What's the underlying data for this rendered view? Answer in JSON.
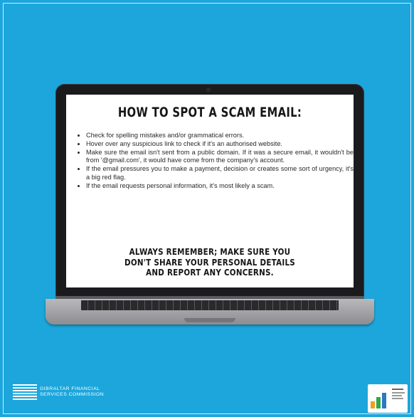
{
  "title": "HOW TO SPOT A SCAM EMAIL:",
  "tips": [
    "Check for spelling mistakes and/or grammatical errors.",
    "Hover over any suspicious link to check if it's an authorised website.",
    "Make sure the email isn't sent from a public domain. If it was a secure email, it wouldn't be from '@gmail.com', it would have come from the company's account.",
    "If the email pressures you to make a payment, decision or creates some sort of urgency, it's a big red flag.",
    "If the email requests personal information, it's most likely a scam."
  ],
  "remember_lines": [
    "ALWAYS REMEMBER; MAKE SURE YOU",
    "DON'T SHARE YOUR PERSONAL DETAILS",
    "AND REPORT ANY CONCERNS."
  ],
  "footer": {
    "gfsc_line1": "GIBRALTAR FINANCIAL",
    "gfsc_line2": "SERVICES COMMISSION"
  },
  "colors": {
    "background": "#1aa7dd",
    "laptop_bezel": "#1b1b1d",
    "screen": "#ffffff"
  }
}
